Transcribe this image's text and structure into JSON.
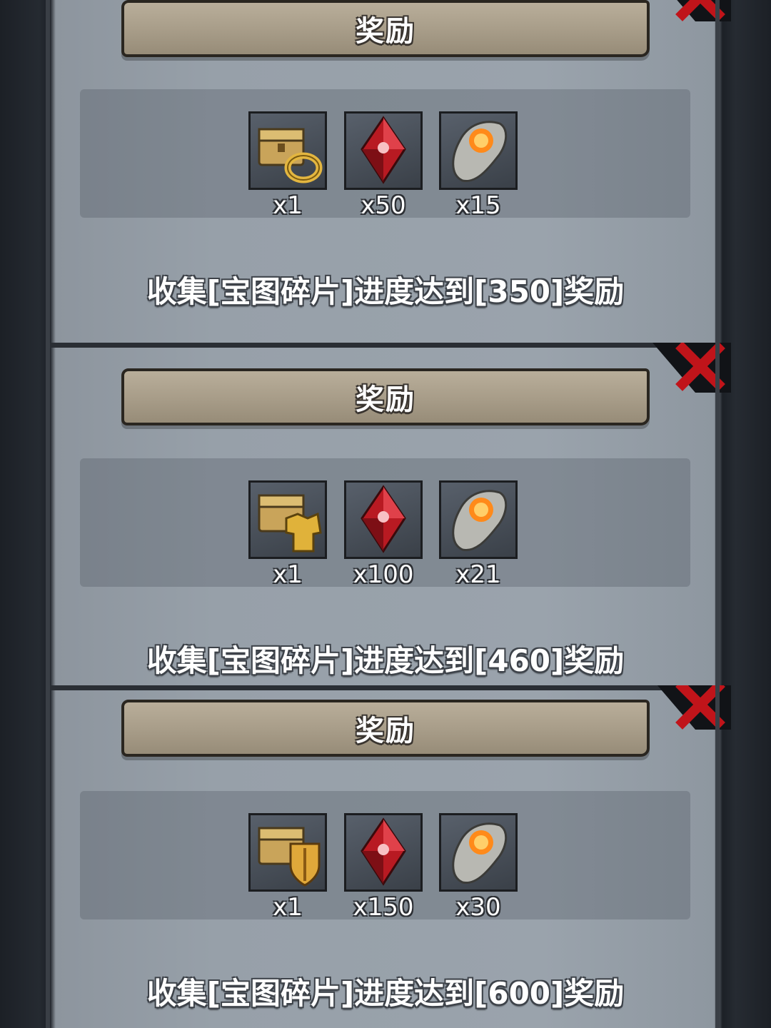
{
  "panels": [
    {
      "title": "奖励",
      "items": [
        {
          "icon": "chest-ring-icon",
          "qty": "x1"
        },
        {
          "icon": "red-crystal-icon",
          "qty": "x50"
        },
        {
          "icon": "fire-stone-icon",
          "qty": "x15"
        }
      ],
      "description": "收集[宝图碎片]进度达到[350]奖励"
    },
    {
      "title": "奖励",
      "items": [
        {
          "icon": "chest-armor-icon",
          "qty": "x1"
        },
        {
          "icon": "red-crystal-icon",
          "qty": "x100"
        },
        {
          "icon": "fire-stone-icon",
          "qty": "x21"
        }
      ],
      "description": "收集[宝图碎片]进度达到[460]奖励"
    },
    {
      "title": "奖励",
      "items": [
        {
          "icon": "chest-shield-icon",
          "qty": "x1"
        },
        {
          "icon": "red-crystal-icon",
          "qty": "x150"
        },
        {
          "icon": "fire-stone-icon",
          "qty": "x30"
        }
      ],
      "description": "收集[宝图碎片]进度达到[600]奖励"
    }
  ],
  "colors": {
    "accent_red": "#c0141a",
    "banner": "#aea38f",
    "panel": "#97a0a9"
  }
}
